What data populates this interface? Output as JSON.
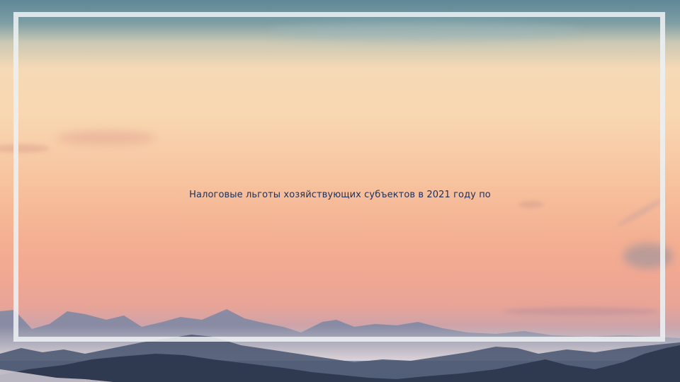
{
  "slide": {
    "title": "Налоговые льготы хозяйствующих субъектов в 2021 году по"
  },
  "colors": {
    "frame": "#ecf0f4",
    "title_text": "#1f2f58",
    "sky_top": "#5f8796",
    "sky_mid": "#f8d7b1",
    "sky_low": "#f1a892",
    "mountains_far": "#6f7f98",
    "mountains_near": "#2e3a4f"
  },
  "icons": [
    "sunset-mountains-background"
  ]
}
